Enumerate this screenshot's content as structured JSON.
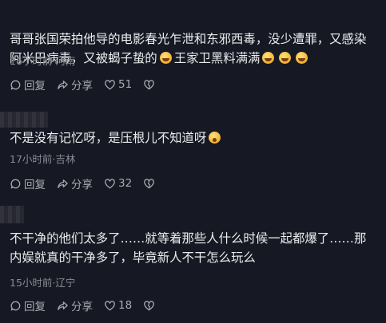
{
  "comments": [
    {
      "text_a": "哥哥张国荣拍他导的电影春光乍泄和东邪西毒，没少遭罪，又感染阿米巴病毒，又被蝎子蛰的",
      "text_b": "王家卫黑料满满",
      "meta": "16小时前·河南",
      "reply_label": "回复",
      "share_label": "分享",
      "likes": "51"
    },
    {
      "text_a": "不是没有记忆呀，是压根儿不知道呀",
      "meta": "17小时前·吉林",
      "reply_label": "回复",
      "share_label": "分享",
      "likes": "32"
    },
    {
      "text_a": "不干净的他们太多了……就等着那些人什么时候一起都爆了……那内娱就真的干净多了，毕竟新人不干怎么玩么",
      "meta": "15小时前·辽宁",
      "reply_label": "回复",
      "share_label": "分享",
      "likes": "18"
    }
  ],
  "icons": {
    "reply": "reply-icon",
    "share": "share-icon",
    "like": "heart-icon",
    "dislike": "dislike-icon"
  },
  "colors": {
    "background": "#161823",
    "text": "#ececee",
    "muted": "#8b8c93"
  }
}
